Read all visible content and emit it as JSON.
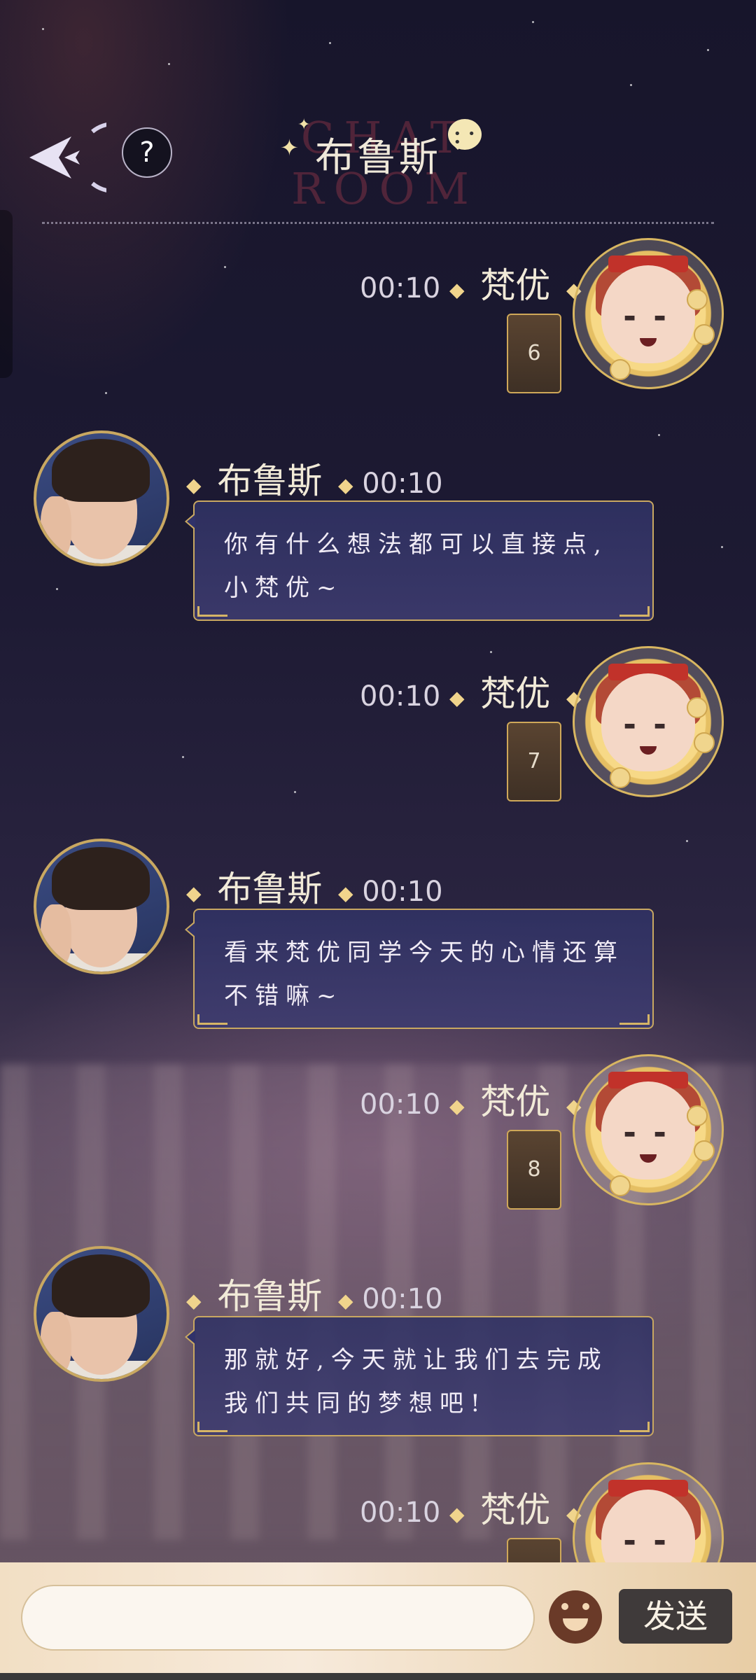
{
  "header": {
    "title": "布鲁斯",
    "watermark": "CHAT ROOM",
    "help_label": "?"
  },
  "messages": [
    {
      "side": "right",
      "sender": "梵优",
      "time": "00:10",
      "text": "6"
    },
    {
      "side": "left",
      "sender": "布鲁斯",
      "time": "00:10",
      "lines": [
        "你有什么想法都可以直接点,",
        "小梵优~"
      ]
    },
    {
      "side": "right",
      "sender": "梵优",
      "time": "00:10",
      "text": "7"
    },
    {
      "side": "left",
      "sender": "布鲁斯",
      "time": "00:10",
      "lines": [
        "看来梵优同学今天的心情还算",
        "不错嘛~"
      ]
    },
    {
      "side": "right",
      "sender": "梵优",
      "time": "00:10",
      "text": "8"
    },
    {
      "side": "left",
      "sender": "布鲁斯",
      "time": "00:10",
      "lines": [
        "那就好,今天就让我们去完成",
        "我们共同的梦想吧!"
      ]
    },
    {
      "side": "right",
      "sender": "梵优",
      "time": "00:10",
      "text": ""
    }
  ],
  "input": {
    "value": "",
    "placeholder": "",
    "send_label": "发送"
  },
  "colors": {
    "accent_gold": "#c9a861",
    "bubble_blue": "#30326a",
    "send_button": "#3f3a3a"
  },
  "icons": {
    "back": "back-arrow-icon",
    "help": "question-icon",
    "chat": "speech-bubble-icon",
    "emoji": "emoji-icon"
  }
}
